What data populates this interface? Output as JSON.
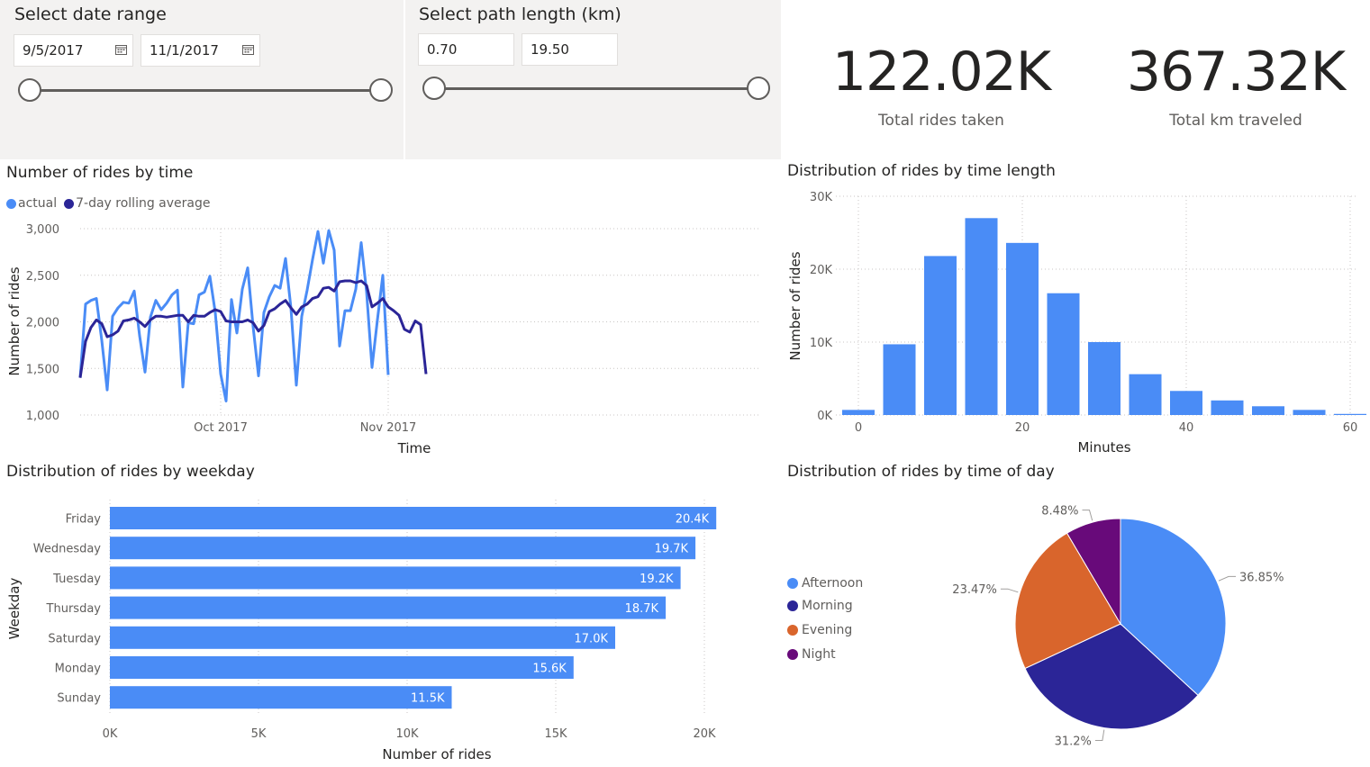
{
  "date_slicer": {
    "title": "Select date range",
    "start": "9/5/2017",
    "end": "11/1/2017",
    "icon": "calendar-icon",
    "range_fraction": [
      0,
      1
    ]
  },
  "length_slicer": {
    "title": "Select path length (km)",
    "min": "0.70",
    "max": "19.50",
    "range_fraction": [
      0,
      1
    ]
  },
  "kpis": [
    {
      "value": "122.02K",
      "label": "Total rides taken"
    },
    {
      "value": "367.32K",
      "label": "Total km traveled"
    }
  ],
  "colors": {
    "actual": "#4a8cf6",
    "rolling": "#2b2597",
    "bar": "#4a8cf6",
    "afternoon": "#4a8cf6",
    "morning": "#2b2597",
    "evening": "#d9652c",
    "night": "#680a7a",
    "slicer_bg": "#f3f2f1"
  },
  "line_visual": {
    "title": "Number of rides by time",
    "legend": [
      "actual",
      "7-day rolling average"
    ],
    "chart_data": {
      "type": "line",
      "title": "Number of rides by time",
      "xlabel": "Time",
      "ylabel": "Number of rides",
      "ylim": [
        1000,
        3000
      ],
      "yticks": [
        "1,000",
        "1,500",
        "2,000",
        "2,500",
        "3,000"
      ],
      "xticks": [
        "Oct 2017",
        "Nov 2017"
      ],
      "x_start": "2017-09-05",
      "grid": true,
      "series": [
        {
          "name": "actual",
          "values": [
            1400,
            2190,
            2230,
            2250,
            1800,
            1270,
            2060,
            2150,
            2210,
            2200,
            2330,
            1850,
            1460,
            2050,
            2230,
            2130,
            2200,
            2290,
            2340,
            1300,
            1990,
            1980,
            2290,
            2320,
            2490,
            2100,
            1440,
            1150,
            2240,
            1880,
            2350,
            2580,
            1950,
            1420,
            2100,
            2270,
            2390,
            2360,
            2680,
            2150,
            1320,
            2060,
            2340,
            2670,
            2970,
            2630,
            2980,
            2770,
            1740,
            2120,
            2120,
            2350,
            2850,
            2320,
            1510,
            2020,
            2500,
            1430
          ]
        },
        {
          "name": "7-day rolling average",
          "values": [
            1400,
            1790,
            1940,
            2020,
            1980,
            1840,
            1860,
            1900,
            2010,
            2020,
            2040,
            2000,
            1950,
            2020,
            2060,
            2060,
            2050,
            2060,
            2070,
            2070,
            2000,
            2070,
            2060,
            2060,
            2100,
            2130,
            2110,
            2010,
            2000,
            2000,
            2000,
            2020,
            1990,
            1900,
            1960,
            2110,
            2140,
            2190,
            2230,
            2150,
            2080,
            2160,
            2190,
            2250,
            2270,
            2360,
            2370,
            2330,
            2430,
            2440,
            2440,
            2420,
            2440,
            2390,
            2160,
            2200,
            2250,
            2160,
            2120,
            2070,
            1920,
            1890,
            2010,
            1970,
            1440
          ]
        }
      ]
    }
  },
  "duration_visual": {
    "title": "Distribution of rides by time length",
    "chart_data": {
      "type": "bar",
      "title": "Distribution of rides by time length",
      "xlabel": "Minutes",
      "ylabel": "Number of rides",
      "ylim": [
        0,
        30000
      ],
      "yticks": [
        "0K",
        "10K",
        "20K",
        "30K"
      ],
      "xticks": [
        "0",
        "20",
        "40",
        "60"
      ],
      "categories": [
        0,
        5,
        10,
        15,
        20,
        25,
        30,
        35,
        40,
        45,
        50,
        55,
        60
      ],
      "values": [
        700,
        9700,
        21800,
        27000,
        23600,
        16700,
        10000,
        5600,
        3300,
        2000,
        1200,
        700,
        150
      ]
    }
  },
  "weekday_visual": {
    "title": "Distribution of rides by weekday",
    "chart_data": {
      "type": "bar",
      "orientation": "horizontal",
      "title": "Distribution of rides by weekday",
      "xlabel": "Number of rides",
      "ylabel": "Weekday",
      "xlim": [
        0,
        21900
      ],
      "xticks": [
        "0K",
        "5K",
        "10K",
        "15K",
        "20K"
      ],
      "categories": [
        "Friday",
        "Wednesday",
        "Tuesday",
        "Thursday",
        "Saturday",
        "Monday",
        "Sunday"
      ],
      "values": [
        20400,
        19700,
        19200,
        18700,
        17000,
        15600,
        11500
      ],
      "data_labels": [
        "20.4K",
        "19.7K",
        "19.2K",
        "18.7K",
        "17.0K",
        "15.6K",
        "11.5K"
      ]
    }
  },
  "timeofday_visual": {
    "title": "Distribution of rides by time of day",
    "chart_data": {
      "type": "pie",
      "title": "Distribution of rides by time of day",
      "legend_position": "left",
      "slices": [
        {
          "name": "Afternoon",
          "value": 36.85,
          "label": "36.85%"
        },
        {
          "name": "Morning",
          "value": 31.2,
          "label": "31.2%"
        },
        {
          "name": "Evening",
          "value": 23.47,
          "label": "23.47%"
        },
        {
          "name": "Night",
          "value": 8.48,
          "label": "8.48%"
        }
      ]
    }
  }
}
